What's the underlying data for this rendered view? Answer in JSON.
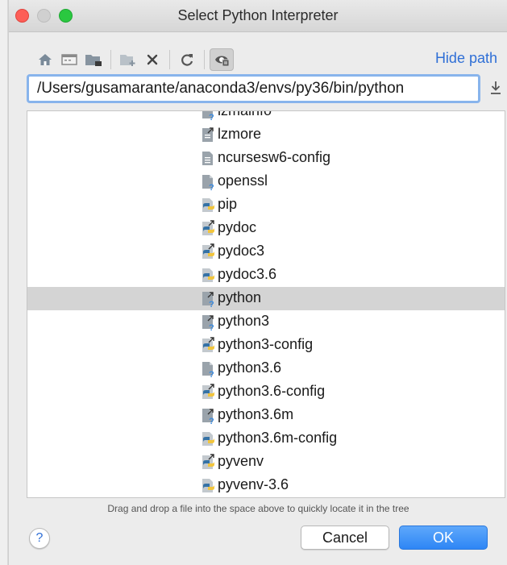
{
  "window": {
    "title": "Select Python Interpreter"
  },
  "toolbar": {
    "hide_path_label": "Hide path",
    "icons": [
      "home-icon",
      "desktop-icon",
      "folder-icon",
      "new-folder-icon",
      "delete-icon",
      "refresh-icon",
      "show-hidden-icon"
    ]
  },
  "path": {
    "value": "/Users/gusamarante/anaconda3/envs/py36/bin/python"
  },
  "tree": {
    "selected": "python",
    "items": [
      {
        "name": "lzmainfo",
        "kind": "unknown"
      },
      {
        "name": "lzmore",
        "kind": "link-file"
      },
      {
        "name": "ncursesw6-config",
        "kind": "text-file"
      },
      {
        "name": "openssl",
        "kind": "unknown"
      },
      {
        "name": "pip",
        "kind": "python"
      },
      {
        "name": "pydoc",
        "kind": "python-link"
      },
      {
        "name": "pydoc3",
        "kind": "python-link"
      },
      {
        "name": "pydoc3.6",
        "kind": "python"
      },
      {
        "name": "python",
        "kind": "unknown-link"
      },
      {
        "name": "python3",
        "kind": "unknown-link"
      },
      {
        "name": "python3-config",
        "kind": "python-link"
      },
      {
        "name": "python3.6",
        "kind": "unknown"
      },
      {
        "name": "python3.6-config",
        "kind": "python-link"
      },
      {
        "name": "python3.6m",
        "kind": "unknown-link"
      },
      {
        "name": "python3.6m-config",
        "kind": "python"
      },
      {
        "name": "pyvenv",
        "kind": "python-link"
      },
      {
        "name": "pyvenv-3.6",
        "kind": "python"
      }
    ]
  },
  "hint": "Drag and drop a file into the space above to quickly locate it in the tree",
  "buttons": {
    "help": "?",
    "cancel": "Cancel",
    "ok": "OK"
  },
  "colors": {
    "accent": "#2f6fd6",
    "ok_button": "#2e86f5",
    "selection": "#d4d4d4"
  }
}
